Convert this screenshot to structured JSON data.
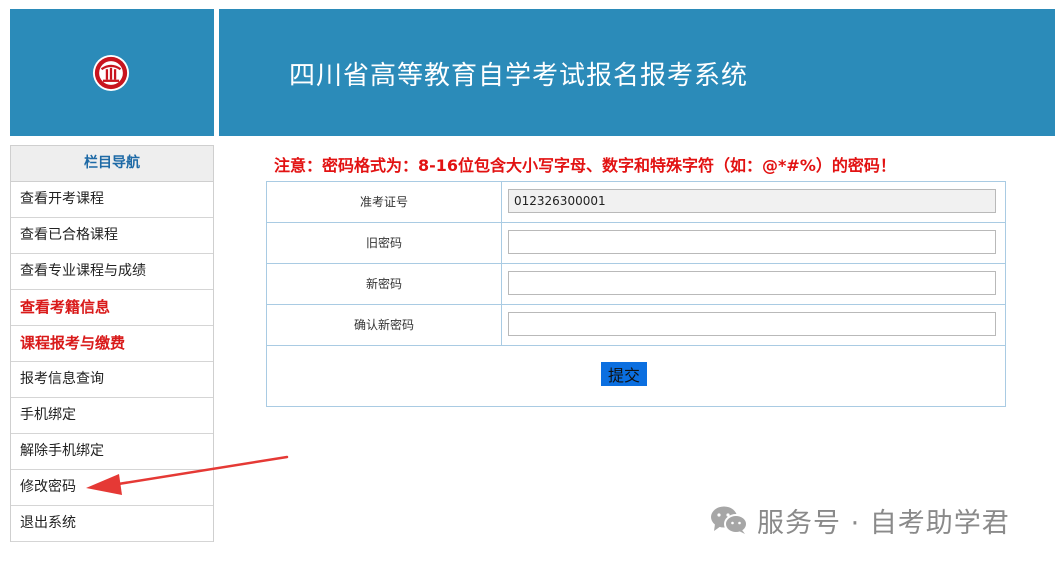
{
  "header": {
    "title": "四川省高等教育自学考试报名报考系统",
    "brand_color": "#2b8bb9"
  },
  "sidebar": {
    "heading": "栏目导航",
    "items": [
      {
        "label": "查看开考课程"
      },
      {
        "label": "查看已合格课程"
      },
      {
        "label": "查看专业课程与成绩"
      },
      {
        "label": "查看考籍信息"
      },
      {
        "label": "课程报考与缴费"
      },
      {
        "label": "报考信息查询"
      },
      {
        "label": "手机绑定"
      },
      {
        "label": "解除手机绑定"
      },
      {
        "label": "修改密码"
      },
      {
        "label": "退出系统"
      }
    ]
  },
  "notice": {
    "text": "注意：密码格式为：8-16位包含大小写字母、数字和特殊字符（如：@*#%）的密码！",
    "color": "#e21212"
  },
  "form": {
    "rows": [
      {
        "label": "准考证号",
        "value": "012326300001"
      },
      {
        "label": "旧密码",
        "value": ""
      },
      {
        "label": "新密码",
        "value": ""
      },
      {
        "label": "确认新密码",
        "value": ""
      }
    ],
    "submit_label": "提交"
  },
  "watermark": {
    "icon": "wechat-icon",
    "text": "服务号 · 自考助学君"
  },
  "annotation": {
    "arrow_color": "#e53935",
    "target": "修改密码"
  }
}
